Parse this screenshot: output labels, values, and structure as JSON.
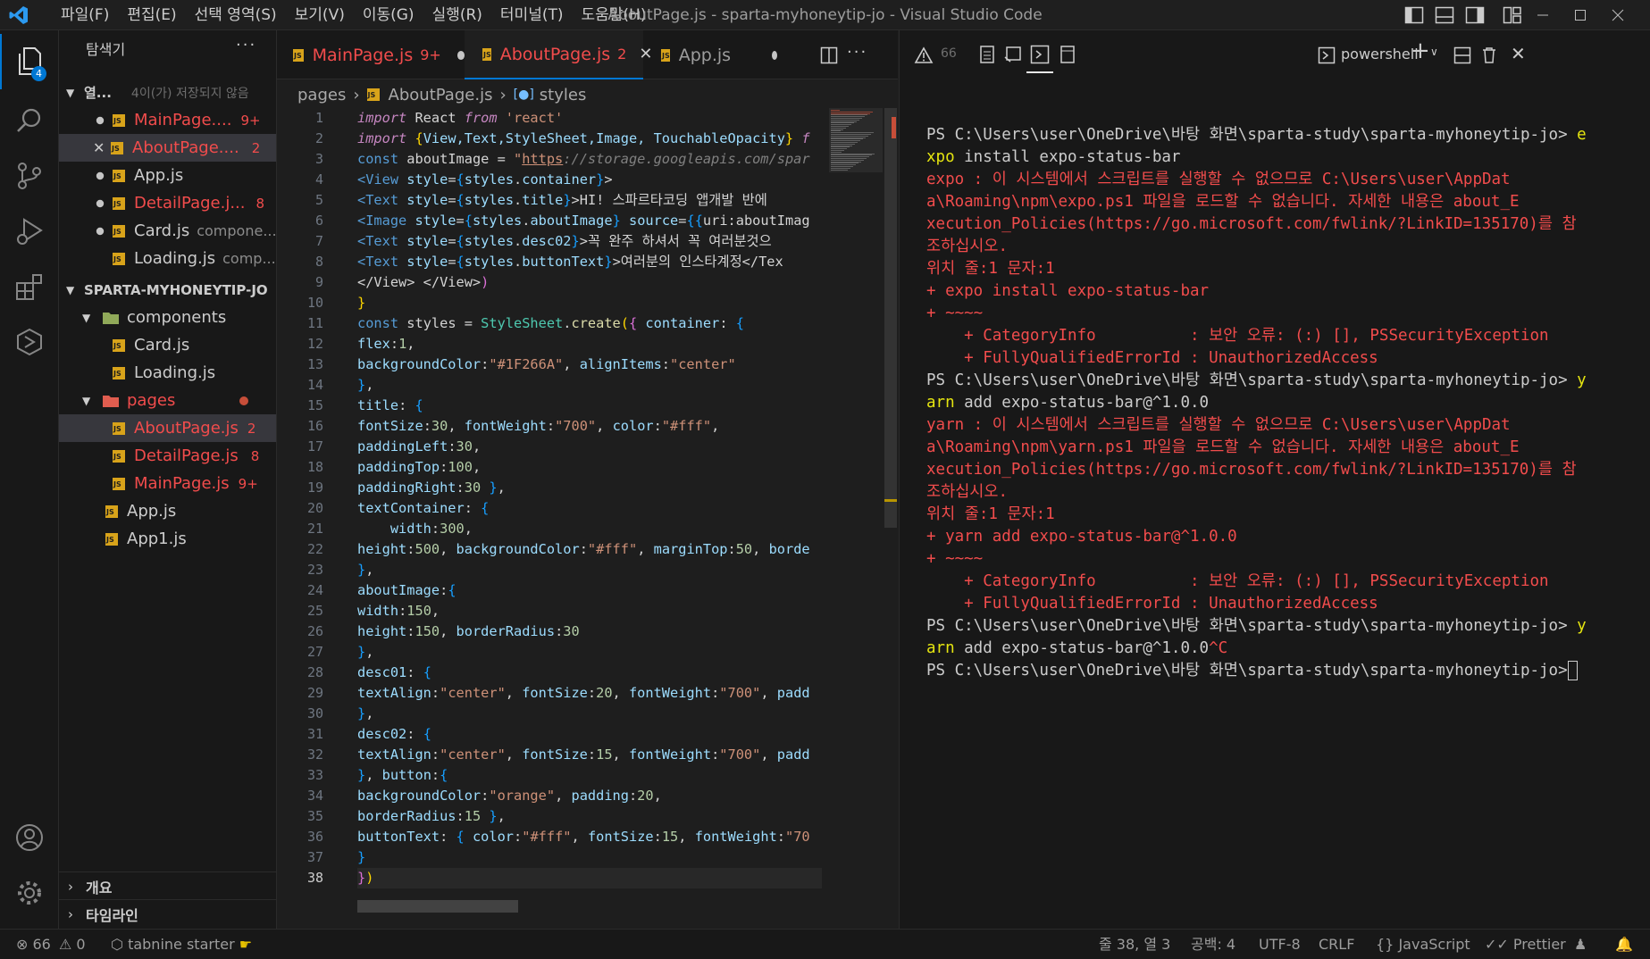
{
  "titlebar": {
    "menu": [
      "파일(F)",
      "편집(E)",
      "선택 영역(S)",
      "보기(V)",
      "이동(G)",
      "실행(R)",
      "터미널(T)",
      "도움말(H)"
    ],
    "window_title": "AboutPage.js - sparta-myhoneytip-jo - Visual Studio Code"
  },
  "activity": {
    "explorer_badge": "4"
  },
  "sidebar": {
    "title": "탐색기",
    "open_editors_label": "열...",
    "open_editors_note": "4이(가) 저장되지 않음",
    "open_editors": [
      {
        "name": "MainPage....",
        "badge": "9+",
        "modified": true
      },
      {
        "name": "AboutPage....",
        "badge": "2",
        "modified": true
      },
      {
        "name": "App.js",
        "badge": "",
        "modified": true
      },
      {
        "name": "DetailPage.j...",
        "badge": "8",
        "modified": true
      },
      {
        "name": "Card.js",
        "detail": "compone...",
        "badge": "",
        "modified": true
      },
      {
        "name": "Loading.js",
        "detail": "comp...",
        "badge": "",
        "modified": false
      }
    ],
    "project_label": "SPARTA-MYHONEYTIP-JO",
    "tree": {
      "components": "components",
      "card": "Card.js",
      "loading": "Loading.js",
      "pages": "pages",
      "about": "AboutPage.js",
      "about_badge": "2",
      "detail": "DetailPage.js",
      "detail_badge": "8",
      "main": "MainPage.js",
      "main_badge": "9+",
      "app": "App.js",
      "app1": "App1.js"
    },
    "outline_label": "개요",
    "timeline_label": "타임라인"
  },
  "editor": {
    "tabs": [
      {
        "name": "MainPage.js",
        "badge": "9+"
      },
      {
        "name": "AboutPage.js",
        "badge": "2"
      },
      {
        "name": "App.js",
        "badge": ""
      }
    ],
    "breadcrumb": [
      "pages",
      "AboutPage.js",
      "styles"
    ],
    "code_lines": [
      [
        [
          "import",
          "kc-i"
        ],
        [
          " React ",
          ""
        ],
        [
          "from",
          "kc-i"
        ],
        [
          " ",
          ""
        ],
        [
          "'react'",
          "s"
        ]
      ],
      [
        [
          "import",
          "kc-i"
        ],
        [
          " ",
          ""
        ],
        [
          "{",
          "by"
        ],
        [
          "View,Text,StyleSheet,Image, TouchableOpacity",
          "p"
        ],
        [
          "}",
          "by"
        ],
        [
          " ",
          ""
        ],
        [
          "f",
          "kc-i"
        ]
      ],
      [
        [
          "const",
          "k"
        ],
        [
          " aboutImage = ",
          ""
        ],
        [
          "\"",
          "s"
        ],
        [
          "https",
          "s-u"
        ],
        [
          "://storage.googleapis.com/spar",
          "tg-i"
        ]
      ],
      [
        [
          "<View ",
          "t0"
        ],
        [
          "style",
          "p"
        ],
        [
          "=",
          ""
        ],
        [
          "{",
          "bb"
        ],
        [
          "styles",
          "p"
        ],
        [
          ".",
          ""
        ],
        [
          "container",
          "p"
        ],
        [
          "}",
          "bb"
        ],
        [
          ">",
          ""
        ]
      ],
      [
        [
          "<Text ",
          "t0"
        ],
        [
          "style",
          "p"
        ],
        [
          "=",
          ""
        ],
        [
          "{",
          "bb"
        ],
        [
          "styles",
          "p"
        ],
        [
          ".",
          ""
        ],
        [
          "title",
          "p"
        ],
        [
          "}",
          "bb"
        ],
        [
          ">HI! 스파르타코딩 앱개발 반에",
          ""
        ]
      ],
      [
        [
          "<Image ",
          "t0"
        ],
        [
          "style",
          "p"
        ],
        [
          "=",
          ""
        ],
        [
          "{",
          "bb"
        ],
        [
          "styles",
          "p"
        ],
        [
          ".",
          ""
        ],
        [
          "aboutImage",
          "p"
        ],
        [
          "}",
          "bb"
        ],
        [
          " ",
          ""
        ],
        [
          "source",
          "p"
        ],
        [
          "=",
          ""
        ],
        [
          "{{",
          "bb"
        ],
        [
          "uri:aboutImag",
          ""
        ]
      ],
      [
        [
          "<Text ",
          "t0"
        ],
        [
          "style",
          "p"
        ],
        [
          "=",
          ""
        ],
        [
          "{",
          "bb"
        ],
        [
          "styles",
          "p"
        ],
        [
          ".",
          ""
        ],
        [
          "desc02",
          "p"
        ],
        [
          "}",
          "bb"
        ],
        [
          ">꼭 완주 하셔서 꼭 여러분것으",
          ""
        ]
      ],
      [
        [
          "<Text ",
          "t0"
        ],
        [
          "style",
          "p"
        ],
        [
          "=",
          ""
        ],
        [
          "{",
          "bb"
        ],
        [
          "styles",
          "p"
        ],
        [
          ".",
          ""
        ],
        [
          "buttonText",
          "p"
        ],
        [
          "}",
          "bb"
        ],
        [
          ">여러분의 인스타계정</Tex",
          ""
        ]
      ],
      [
        [
          "</View> </View>",
          ""
        ],
        [
          ")",
          "b"
        ]
      ],
      [
        [
          "}",
          "by"
        ]
      ],
      [
        [
          "const",
          "k"
        ],
        [
          " styles = ",
          ""
        ],
        [
          "StyleSheet",
          "t"
        ],
        [
          ".",
          ""
        ],
        [
          "create",
          "f"
        ],
        [
          "(",
          "by"
        ],
        [
          "{",
          "b"
        ],
        [
          " ",
          ""
        ],
        [
          "container",
          "p"
        ],
        [
          ": ",
          ""
        ],
        [
          "{",
          "bb"
        ]
      ],
      [
        [
          "flex",
          "p"
        ],
        [
          ":",
          ""
        ],
        [
          "1",
          "n"
        ],
        [
          ",",
          ""
        ]
      ],
      [
        [
          "backgroundColor",
          "p"
        ],
        [
          ":",
          ""
        ],
        [
          "\"#1F266A\"",
          "s"
        ],
        [
          ", ",
          ""
        ],
        [
          "alignItems",
          "p"
        ],
        [
          ":",
          ""
        ],
        [
          "\"center\"",
          "s"
        ]
      ],
      [
        [
          "}",
          "bb"
        ],
        [
          ",",
          ""
        ]
      ],
      [
        [
          "title",
          "p"
        ],
        [
          ": ",
          ""
        ],
        [
          "{",
          "bb"
        ]
      ],
      [
        [
          "fontSize",
          "p"
        ],
        [
          ":",
          ""
        ],
        [
          "30",
          "n"
        ],
        [
          ", ",
          ""
        ],
        [
          "fontWeight",
          "p"
        ],
        [
          ":",
          ""
        ],
        [
          "\"700\"",
          "s"
        ],
        [
          ", ",
          ""
        ],
        [
          "color",
          "p"
        ],
        [
          ":",
          ""
        ],
        [
          "\"#fff\"",
          "s"
        ],
        [
          ",",
          ""
        ]
      ],
      [
        [
          "paddingLeft",
          "p"
        ],
        [
          ":",
          ""
        ],
        [
          "30",
          "n"
        ],
        [
          ",",
          ""
        ]
      ],
      [
        [
          "paddingTop",
          "p"
        ],
        [
          ":",
          ""
        ],
        [
          "100",
          "n"
        ],
        [
          ",",
          ""
        ]
      ],
      [
        [
          "paddingRight",
          "p"
        ],
        [
          ":",
          ""
        ],
        [
          "30",
          "n"
        ],
        [
          " ",
          ""
        ],
        [
          "}",
          "bb"
        ],
        [
          ",",
          ""
        ]
      ],
      [
        [
          "textContainer",
          "p"
        ],
        [
          ": ",
          ""
        ],
        [
          "{",
          "bb"
        ]
      ],
      [
        [
          "    width",
          "p"
        ],
        [
          ":",
          ""
        ],
        [
          "300",
          "n"
        ],
        [
          ",",
          ""
        ]
      ],
      [
        [
          "height",
          "p"
        ],
        [
          ":",
          ""
        ],
        [
          "500",
          "n"
        ],
        [
          ", ",
          ""
        ],
        [
          "backgroundColor",
          "p"
        ],
        [
          ":",
          ""
        ],
        [
          "\"#fff\"",
          "s"
        ],
        [
          ", ",
          ""
        ],
        [
          "marginTop",
          "p"
        ],
        [
          ":",
          ""
        ],
        [
          "50",
          "n"
        ],
        [
          ", ",
          ""
        ],
        [
          "borde",
          "p"
        ]
      ],
      [
        [
          "}",
          "bb"
        ],
        [
          ",",
          ""
        ]
      ],
      [
        [
          "aboutImage",
          "p"
        ],
        [
          ":",
          ""
        ],
        [
          "{",
          "bb"
        ]
      ],
      [
        [
          "width",
          "p"
        ],
        [
          ":",
          ""
        ],
        [
          "150",
          "n"
        ],
        [
          ",",
          ""
        ]
      ],
      [
        [
          "height",
          "p"
        ],
        [
          ":",
          ""
        ],
        [
          "150",
          "n"
        ],
        [
          ", ",
          ""
        ],
        [
          "borderRadius",
          "p"
        ],
        [
          ":",
          ""
        ],
        [
          "30",
          "n"
        ]
      ],
      [
        [
          "}",
          "bb"
        ],
        [
          ",",
          ""
        ]
      ],
      [
        [
          "desc01",
          "p"
        ],
        [
          ": ",
          ""
        ],
        [
          "{",
          "bb"
        ]
      ],
      [
        [
          "textAlign",
          "p"
        ],
        [
          ":",
          ""
        ],
        [
          "\"center\"",
          "s"
        ],
        [
          ", ",
          ""
        ],
        [
          "fontSize",
          "p"
        ],
        [
          ":",
          ""
        ],
        [
          "20",
          "n"
        ],
        [
          ", ",
          ""
        ],
        [
          "fontWeight",
          "p"
        ],
        [
          ":",
          ""
        ],
        [
          "\"700\"",
          "s"
        ],
        [
          ", ",
          ""
        ],
        [
          "padd",
          "p"
        ]
      ],
      [
        [
          "}",
          "bb"
        ],
        [
          ",",
          ""
        ]
      ],
      [
        [
          "desc02",
          "p"
        ],
        [
          ": ",
          ""
        ],
        [
          "{",
          "bb"
        ]
      ],
      [
        [
          "textAlign",
          "p"
        ],
        [
          ":",
          ""
        ],
        [
          "\"center\"",
          "s"
        ],
        [
          ", ",
          ""
        ],
        [
          "fontSize",
          "p"
        ],
        [
          ":",
          ""
        ],
        [
          "15",
          "n"
        ],
        [
          ", ",
          ""
        ],
        [
          "fontWeight",
          "p"
        ],
        [
          ":",
          ""
        ],
        [
          "\"700\"",
          "s"
        ],
        [
          ", ",
          ""
        ],
        [
          "padd",
          "p"
        ]
      ],
      [
        [
          "}",
          "bb"
        ],
        [
          ", ",
          ""
        ],
        [
          "button",
          "p"
        ],
        [
          ":",
          ""
        ],
        [
          "{",
          "bb"
        ]
      ],
      [
        [
          "backgroundColor",
          "p"
        ],
        [
          ":",
          ""
        ],
        [
          "\"orange\"",
          "s"
        ],
        [
          ", ",
          ""
        ],
        [
          "padding",
          "p"
        ],
        [
          ":",
          ""
        ],
        [
          "20",
          "n"
        ],
        [
          ",",
          ""
        ]
      ],
      [
        [
          "borderRadius",
          "p"
        ],
        [
          ":",
          ""
        ],
        [
          "15",
          "n"
        ],
        [
          " ",
          ""
        ],
        [
          "}",
          "bb"
        ],
        [
          ",",
          ""
        ]
      ],
      [
        [
          "buttonText",
          "p"
        ],
        [
          ": ",
          ""
        ],
        [
          "{",
          "bb"
        ],
        [
          " ",
          ""
        ],
        [
          "color",
          "p"
        ],
        [
          ":",
          ""
        ],
        [
          "\"#fff\"",
          "s"
        ],
        [
          ", ",
          ""
        ],
        [
          "fontSize",
          "p"
        ],
        [
          ":",
          ""
        ],
        [
          "15",
          "n"
        ],
        [
          ", ",
          ""
        ],
        [
          "fontWeight",
          "p"
        ],
        [
          ":",
          ""
        ],
        [
          "\"70",
          "s"
        ]
      ],
      [
        [
          "}",
          "bb"
        ]
      ],
      [
        [
          "}",
          "b"
        ],
        [
          ")",
          "by"
        ]
      ]
    ]
  },
  "terminal": {
    "problems_count": "66",
    "shell_label": "powershell",
    "lines": [
      [
        [
          "PS C:\\Users\\user\\OneDrive\\바탕 화면\\sparta-study\\sparta-myhoneytip-jo> ",
          ""
        ],
        [
          "e",
          "ty"
        ]
      ],
      [
        [
          "xpo",
          "ty"
        ],
        [
          " install expo-status-bar",
          ""
        ]
      ],
      [
        [
          "expo : 이 시스템에서 스크립트를 실행할 수 없으므로 C:\\Users\\user\\AppDat",
          "te"
        ]
      ],
      [
        [
          "a\\Roaming\\npm\\expo.ps1 파일을 로드할 수 없습니다. 자세한 내용은 about_E",
          "te"
        ]
      ],
      [
        [
          "xecution_Policies(https://go.microsoft.com/fwlink/?LinkID=135170)를 참",
          "te"
        ]
      ],
      [
        [
          "조하십시오.",
          "te"
        ]
      ],
      [
        [
          "위치 줄:1 문자:1",
          "te"
        ]
      ],
      [
        [
          "+ expo install expo-status-bar",
          "te"
        ]
      ],
      [
        [
          "+ ~~~~",
          "te"
        ]
      ],
      [
        [
          "    + CategoryInfo          : 보안 오류: (:) [], PSSecurityException",
          "te"
        ]
      ],
      [
        [
          "    + FullyQualifiedErrorId : UnauthorizedAccess",
          "te"
        ]
      ],
      [
        [
          "PS C:\\Users\\user\\OneDrive\\바탕 화면\\sparta-study\\sparta-myhoneytip-jo> ",
          ""
        ],
        [
          "y",
          "ty"
        ]
      ],
      [
        [
          "arn",
          "ty"
        ],
        [
          " add expo-status-bar@^1.0.0",
          ""
        ]
      ],
      [
        [
          "yarn : 이 시스템에서 스크립트를 실행할 수 없으므로 C:\\Users\\user\\AppDat",
          "te"
        ]
      ],
      [
        [
          "a\\Roaming\\npm\\yarn.ps1 파일을 로드할 수 없습니다. 자세한 내용은 about_E",
          "te"
        ]
      ],
      [
        [
          "xecution_Policies(https://go.microsoft.com/fwlink/?LinkID=135170)를 참",
          "te"
        ]
      ],
      [
        [
          "조하십시오.",
          "te"
        ]
      ],
      [
        [
          "위치 줄:1 문자:1",
          "te"
        ]
      ],
      [
        [
          "+ yarn add expo-status-bar@^1.0.0",
          "te"
        ]
      ],
      [
        [
          "+ ~~~~",
          "te"
        ]
      ],
      [
        [
          "    + CategoryInfo          : 보안 오류: (:) [], PSSecurityException",
          "te"
        ]
      ],
      [
        [
          "    + FullyQualifiedErrorId : UnauthorizedAccess",
          "te"
        ]
      ],
      [
        [
          "PS C:\\Users\\user\\OneDrive\\바탕 화면\\sparta-study\\sparta-myhoneytip-jo> ",
          ""
        ],
        [
          "y",
          "ty"
        ]
      ],
      [
        [
          "arn",
          "ty"
        ],
        [
          " add expo-status-bar@^1.0.0",
          ""
        ],
        [
          "^C",
          "te"
        ]
      ],
      [
        [
          "PS C:\\Users\\user\\OneDrive\\바탕 화면\\sparta-study\\sparta-myhoneytip-jo>",
          ""
        ]
      ]
    ]
  },
  "statusbar": {
    "errors": "66",
    "warnings": "0",
    "tabnine": "tabnine starter",
    "position": "줄 38, 열 3",
    "spaces": "공백: 4",
    "encoding": "UTF-8",
    "eol": "CRLF",
    "language": "JavaScript",
    "prettier": "Prettier"
  },
  "colors": {
    "accent": "#0078d4",
    "error": "#f14c4c",
    "modified_js": "#e2a13b"
  }
}
